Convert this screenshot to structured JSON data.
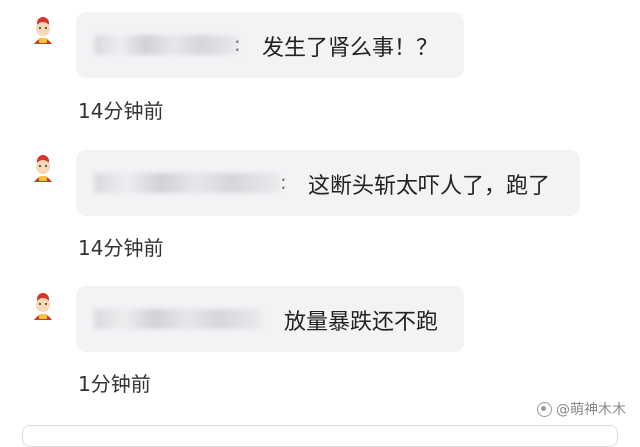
{
  "comments": [
    {
      "message": "发生了肾么事！？",
      "time": "14分钟前"
    },
    {
      "message": "这断头斩太吓人了，跑了",
      "time": "14分钟前"
    },
    {
      "message": "放量暴跌还不跑",
      "time": "1分钟前"
    }
  ],
  "watermark": "@萌神木木",
  "colors": {
    "bubble": "#f2f3f5",
    "text": "#222222",
    "avatar_red": "#d9342b"
  }
}
